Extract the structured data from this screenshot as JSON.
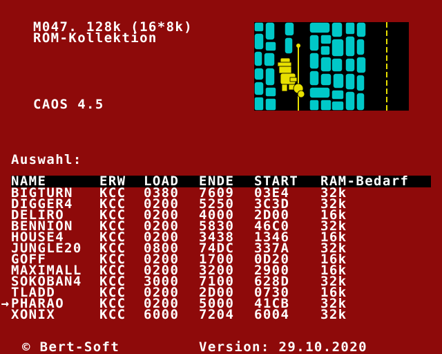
{
  "header": {
    "title_line1": "M047. 128k (16*8k)",
    "title_line2": "ROM-Kollektion",
    "os_version": "CAOS 4.5"
  },
  "menu": {
    "prompt": "Auswahl:",
    "columns": {
      "name": "NAME",
      "erw": "ERW",
      "load": "LOAD",
      "ende": "ENDE",
      "start": "START",
      "ram": "RAM-Bedarf"
    },
    "cursor_symbol": "→",
    "selected_index": 10,
    "rows": [
      {
        "name": "BIGTURN",
        "erw": "KCC",
        "load": "0380",
        "ende": "7609",
        "start": "03E4",
        "ram": "32k"
      },
      {
        "name": "DIGGER4",
        "erw": "KCC",
        "load": "0200",
        "ende": "5250",
        "start": "3C3D",
        "ram": "32k"
      },
      {
        "name": "DELIRO",
        "erw": "KCC",
        "load": "0200",
        "ende": "4000",
        "start": "2D00",
        "ram": "16k"
      },
      {
        "name": "BENNION",
        "erw": "KCC",
        "load": "0200",
        "ende": "5830",
        "start": "46C0",
        "ram": "32k"
      },
      {
        "name": "HOUSE4",
        "erw": "KCC",
        "load": "0200",
        "ende": "3438",
        "start": "1346",
        "ram": "16k"
      },
      {
        "name": "JUNGLE20",
        "erw": "KCC",
        "load": "0800",
        "ende": "74DC",
        "start": "337A",
        "ram": "32k"
      },
      {
        "name": "GOFF",
        "erw": "KCC",
        "load": "0200",
        "ende": "1700",
        "start": "0D20",
        "ram": "16k"
      },
      {
        "name": "MAXIMALL",
        "erw": "KCC",
        "load": "0200",
        "ende": "3200",
        "start": "2900",
        "ram": "16k"
      },
      {
        "name": "SOKOBAN4",
        "erw": "KCC",
        "load": "3000",
        "ende": "7100",
        "start": "628D",
        "ram": "32k"
      },
      {
        "name": "TLADD",
        "erw": "KCC",
        "load": "0200",
        "ende": "2D00",
        "start": "0730",
        "ram": "16k"
      },
      {
        "name": "PHARAO",
        "erw": "KCC",
        "load": "0200",
        "ende": "5000",
        "start": "41CB",
        "ram": "32k"
      },
      {
        "name": "XONIX",
        "erw": "KCC",
        "load": "6000",
        "ende": "7204",
        "start": "6004",
        "ram": "32k"
      }
    ]
  },
  "footer": {
    "copyright": "© Bert-Soft",
    "version": "Version: 29.10.2020"
  },
  "colors": {
    "background": "#8e0a0a",
    "text": "#ffffff",
    "header_bar": "#000000",
    "preview_wall": "#00c8c8",
    "preview_sprite": "#e8e000"
  }
}
